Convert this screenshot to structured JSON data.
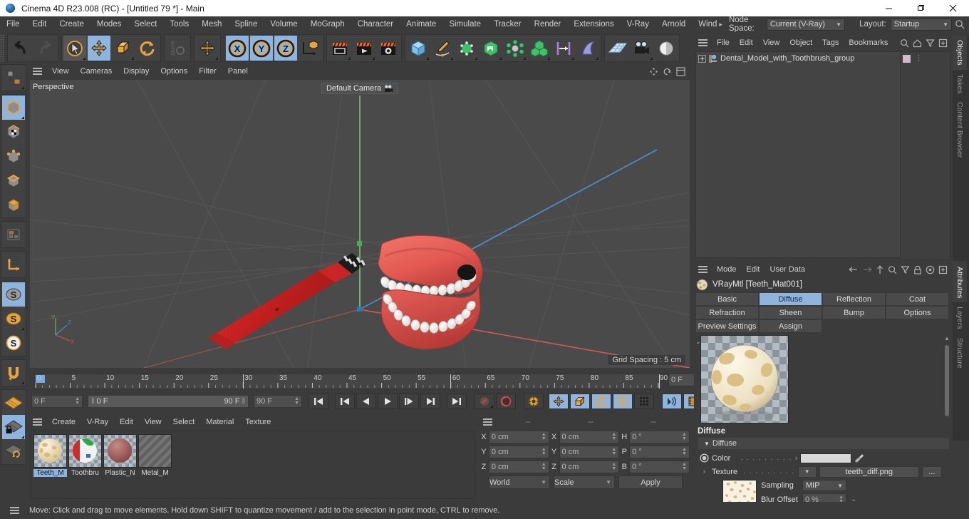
{
  "window": {
    "title": "Cinema 4D R23.008 (RC) - [Untitled 79 *] - Main",
    "app_icon": "cinema4d-logo-icon",
    "minimize": "—",
    "maximize": "❐",
    "close": "✕"
  },
  "menubar": {
    "items": [
      "File",
      "Edit",
      "Create",
      "Modes",
      "Select",
      "Tools",
      "Mesh",
      "Spline",
      "Volume",
      "MoGraph",
      "Character",
      "Animate",
      "Simulate",
      "Tracker",
      "Render",
      "Extensions",
      "V-Ray",
      "Arnold",
      "Wind"
    ],
    "overflow_arrow": "▸",
    "node_space_label": "Node Space:",
    "node_space_value": "Current (V-Ray)",
    "layout_label": "Layout:",
    "layout_value": "Startup",
    "search_icon": "search-icon"
  },
  "toolbar": {
    "undo": "undo-icon",
    "redo": "redo-icon",
    "select": "live-selection-icon",
    "move": "move-icon",
    "scale": "scale-icon",
    "rotate": "rotate-icon",
    "psr": "psr-icon",
    "move_dup": "move-tool-icon",
    "axis_x": "X",
    "axis_y": "Y",
    "axis_z": "Z",
    "world_axis": "world-object-axis-icon",
    "render_view": "render-view-icon",
    "render_picture_viewer": "render-to-picture-viewer-icon",
    "render_settings": "render-settings-icon",
    "cube": "add-cube-icon",
    "pen": "add-spline-icon",
    "nurbs": "generator-icon",
    "deform_parent": "scene-nodes-icon",
    "array": "array-icon",
    "cloner": "mograph-cloner-icon",
    "fields": "field-icon",
    "deformer": "deformer-icon",
    "floor": "environment-icon",
    "camera": "camera-icon",
    "light": "light-icon"
  },
  "left_toolbar": {
    "items": [
      {
        "name": "make-editable-icon",
        "active": false
      },
      {
        "name": "model-mode-icon",
        "active": true
      },
      {
        "name": "texture-mode-icon",
        "active": false
      },
      {
        "name": "points-mode-icon",
        "active": false
      },
      {
        "name": "edges-mode-icon",
        "active": false
      },
      {
        "name": "polygons-mode-icon",
        "active": false
      },
      {
        "name": "uv-mode-icon",
        "active": false
      },
      {
        "name": "axis-modify-icon",
        "active": false
      },
      {
        "name": "enable-axis-icon",
        "active": true
      },
      {
        "name": "object-axis-icon",
        "active": false
      },
      {
        "name": "world-axis-icon",
        "active": false
      },
      {
        "name": "snap-icon",
        "active": false
      },
      {
        "name": "workplane-icon",
        "active": false
      },
      {
        "name": "lock-workplane-icon",
        "active": true
      },
      {
        "name": "planar-workplane-icon",
        "active": false
      }
    ]
  },
  "viewport": {
    "menu": [
      "View",
      "Cameras",
      "Display",
      "Options",
      "Filter",
      "Panel"
    ],
    "perspective_label": "Perspective",
    "camera_label": "Default Camera",
    "camera_icon": "camera-icon",
    "grid_spacing": "Grid Spacing : 5 cm",
    "axis_labels": {
      "x": "X",
      "y": "Y",
      "z": "Z"
    },
    "background": "#4a4a4a"
  },
  "timeline": {
    "ticks": [
      0,
      5,
      10,
      15,
      20,
      25,
      30,
      35,
      40,
      45,
      50,
      55,
      60,
      65,
      70,
      75,
      80,
      85,
      90
    ],
    "current_frame": "0 F",
    "range_start": "0 F",
    "range_end": "90 F",
    "max_frame": "90 F",
    "frame_field_right": "0 F",
    "transport": [
      {
        "name": "go-to-start-button",
        "icon": "skip-start-icon"
      },
      {
        "name": "previous-keyframe-button",
        "icon": "prev-key-icon"
      },
      {
        "name": "previous-frame-button",
        "icon": "step-back-icon"
      },
      {
        "name": "play-button",
        "icon": "play-icon"
      },
      {
        "name": "next-frame-button",
        "icon": "step-forward-icon"
      },
      {
        "name": "next-keyframe-button",
        "icon": "next-key-icon"
      },
      {
        "name": "go-to-end-button",
        "icon": "skip-end-icon"
      }
    ],
    "record_buttons": [
      {
        "name": "record-active-objects-button",
        "icon": "record-key-icon"
      },
      {
        "name": "autokeying-button",
        "icon": "autokey-icon"
      },
      {
        "name": "keyframe-selection-button",
        "icon": "key-selection-icon"
      },
      {
        "name": "position-key-button",
        "icon": "position-key-icon",
        "active": true
      },
      {
        "name": "scale-key-button",
        "icon": "scale-key-icon",
        "active": true
      },
      {
        "name": "rotation-key-button",
        "icon": "rotation-key-icon",
        "active": true
      },
      {
        "name": "parameter-key-button",
        "icon": "param-key-icon",
        "active": true
      },
      {
        "name": "point-level-anim-button",
        "icon": "pla-icon"
      }
    ],
    "extra_buttons": [
      {
        "name": "sound-button",
        "icon": "sound-icon",
        "active": true
      },
      {
        "name": "film-strip-button",
        "icon": "film-icon",
        "active": true
      }
    ]
  },
  "material_manager": {
    "menu": [
      "Create",
      "V-Ray",
      "Edit",
      "View",
      "Select",
      "Material",
      "Texture"
    ],
    "materials": [
      {
        "name": "Teeth_M",
        "selected": true,
        "swatch": "teeth-material-thumb"
      },
      {
        "name": "Toothbru",
        "selected": false,
        "swatch": "toothbrush-material-thumb"
      },
      {
        "name": "Plastic_N",
        "selected": false,
        "swatch": "plastic-material-thumb"
      },
      {
        "name": "Metal_M",
        "selected": false,
        "swatch": "metal-material-thumb"
      }
    ]
  },
  "coordinates": {
    "headers": [
      "--",
      "--",
      "--"
    ],
    "rows": [
      {
        "pos_label": "X",
        "pos_value": "0 cm",
        "size_label": "X",
        "size_value": "0 cm",
        "rot_label": "H",
        "rot_value": "0 °"
      },
      {
        "pos_label": "Y",
        "pos_value": "0 cm",
        "size_label": "Y",
        "size_value": "0 cm",
        "rot_label": "P",
        "rot_value": "0 °"
      },
      {
        "pos_label": "Z",
        "pos_value": "0 cm",
        "size_label": "Z",
        "size_value": "0 cm",
        "rot_label": "B",
        "rot_value": "0 °"
      }
    ],
    "system": "World",
    "mode": "Scale",
    "apply": "Apply"
  },
  "object_manager": {
    "menu": [
      "File",
      "Edit",
      "View",
      "Object",
      "Tags",
      "Bookmarks"
    ],
    "icons": [
      "search-icon",
      "home-icon",
      "filter-icon",
      "add-icon"
    ],
    "objects": [
      {
        "name": "Dental_Model_with_Toothbrush_group",
        "expand": "+",
        "icon": "null-object-icon",
        "tag_color": "#d6b8c8"
      }
    ]
  },
  "attributes": {
    "menu": [
      "Mode",
      "Edit",
      "User Data"
    ],
    "nav_icons": [
      "back-arrow-icon",
      "forward-arrow-icon",
      "up-arrow-icon",
      "search-icon",
      "filter-icon",
      "lock-icon",
      "target-icon",
      "add-icon"
    ],
    "object_title": "VRayMtl [Teeth_Mat001]",
    "object_icon": "material-sphere-icon",
    "tabs": [
      {
        "label": "Basic",
        "active": false
      },
      {
        "label": "Diffuse",
        "active": true
      },
      {
        "label": "Reflection",
        "active": false
      },
      {
        "label": "Coat",
        "active": false
      },
      {
        "label": "Refraction",
        "active": false
      },
      {
        "label": "Sheen",
        "active": false
      },
      {
        "label": "Bump",
        "active": false
      },
      {
        "label": "Options",
        "active": false
      },
      {
        "label": "Preview Settings",
        "active": false
      },
      {
        "label": "Assign",
        "active": false
      }
    ],
    "section_title": "Diffuse",
    "group_label": "Diffuse",
    "properties": {
      "color_label": "Color",
      "color_dots": ". . . . . . . . .",
      "color_value": "#d8d8d8",
      "color_arrow": "›",
      "eyedropper": "eyedropper-icon",
      "texture_label": "Texture",
      "texture_dots": ". . . . . . . . .",
      "texture_value": "teeth_diff.png",
      "texture_browse": "...",
      "sampling_label": "Sampling",
      "sampling_value": "MIP",
      "blur_offset_label": "Blur Offset",
      "blur_offset_value": "0 %"
    }
  },
  "right_tabs_top": [
    {
      "label": "Objects",
      "active": true
    },
    {
      "label": "Takes",
      "active": false
    },
    {
      "label": "Content Browser",
      "active": false
    }
  ],
  "right_tabs_bottom": [
    {
      "label": "Attributes",
      "active": true
    },
    {
      "label": "Layers",
      "active": false
    },
    {
      "label": "Structure",
      "active": false
    }
  ],
  "statusbar": {
    "text": "Move: Click and drag to move elements. Hold down SHIFT to quantize movement / add to the selection in point mode, CTRL to remove."
  },
  "colors": {
    "accent": "#8fb4dd",
    "panel_bg": "#3b3b3b",
    "viewport_bg": "#4a4a4a",
    "orange": "#e8a33d",
    "model_red": "#d94242",
    "axis_x": "#c0504d",
    "axis_y": "#6aa84f",
    "axis_z": "#4a86c8"
  }
}
